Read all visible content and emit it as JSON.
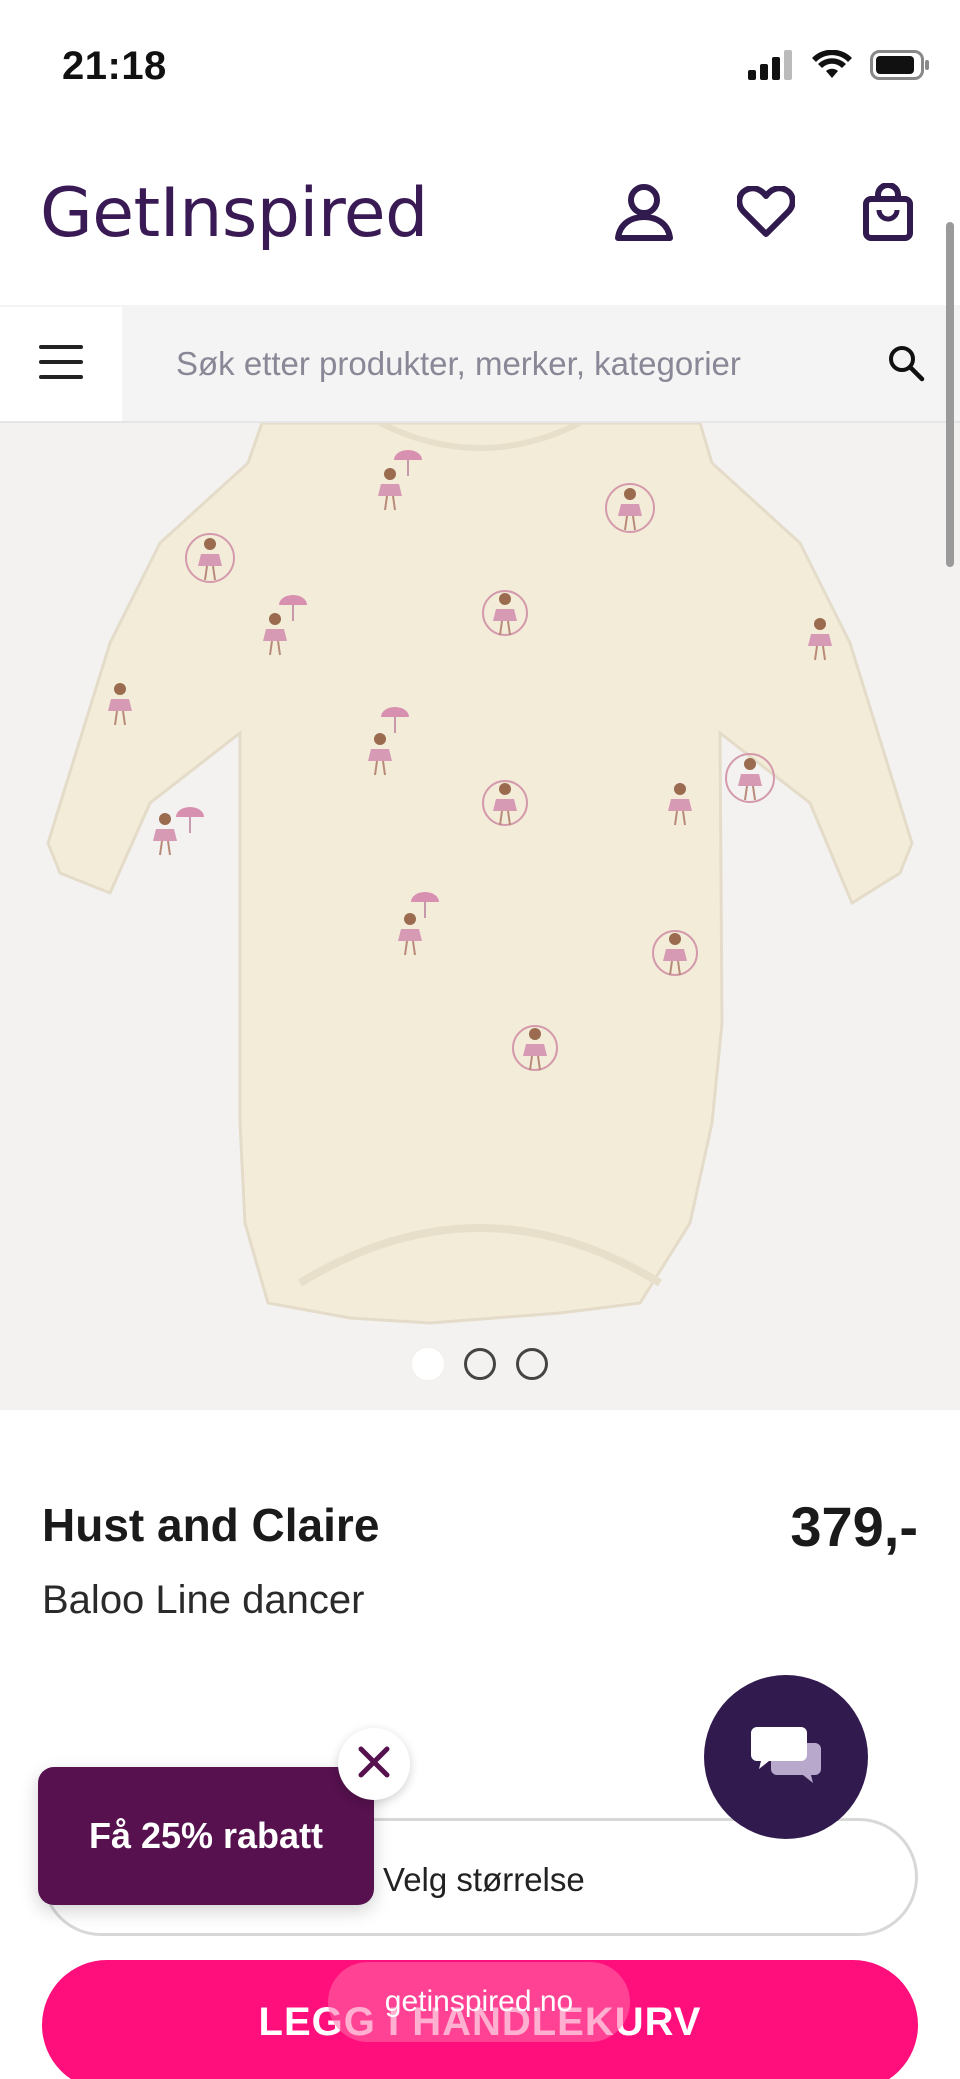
{
  "status_bar": {
    "time": "21:18"
  },
  "header": {
    "logo": "GetInspired",
    "icons": [
      "user-icon",
      "heart-icon",
      "shopping-bag-icon"
    ]
  },
  "search": {
    "placeholder": "Søk etter produkter, merker, kategorier"
  },
  "gallery": {
    "image_count": 3,
    "active_index": 0
  },
  "product": {
    "brand": "Hust and Claire",
    "price": "379,-",
    "name": "Baloo Line dancer"
  },
  "size_select": {
    "label": "Velg størrelse"
  },
  "cart_button": {
    "label": "LEGG I HANDLEKURV"
  },
  "browser": {
    "url": "getinspired.no"
  },
  "discount_popup": {
    "label": "Få 25% rabatt"
  },
  "colors": {
    "brand_purple": "#3a1a55",
    "cart_pink": "#ff0f7b",
    "popup_purple": "#56114e",
    "chat_purple": "#311a4d"
  }
}
